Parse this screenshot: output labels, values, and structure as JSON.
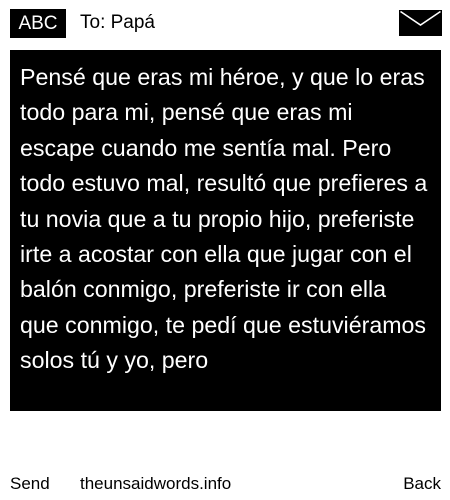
{
  "header": {
    "mode_label": "ABC",
    "recipient": "To: Papá",
    "icon": "envelope-icon"
  },
  "message": {
    "body": "Pensé que eras mi héroe, y que lo eras todo para mi, pensé que eras mi escape cuando me sentía mal. Pero todo estuvo mal, resultó que prefieres a tu novia que a tu propio hijo, preferiste irte a acostar con ella que jugar con el balón conmigo, preferiste ir con ella que conmigo, te pedí que estuviéramos solos tú y yo, pero"
  },
  "footer": {
    "left_softkey": "Send",
    "site": "theunsaidwords.info",
    "right_softkey": "Back"
  },
  "colors": {
    "background": "#ffffff",
    "message_background": "#000000",
    "message_text": "#ffffff"
  }
}
